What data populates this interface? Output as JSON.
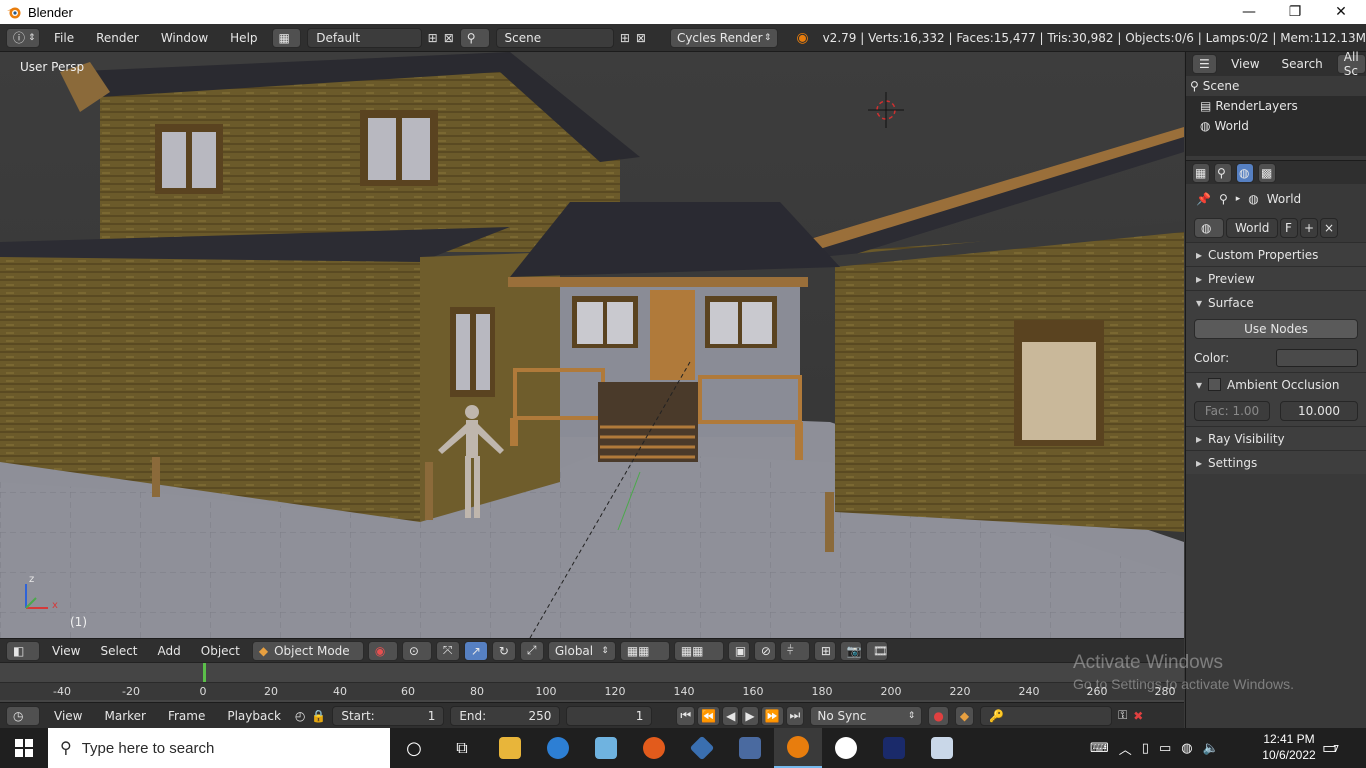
{
  "window": {
    "title": "Blender",
    "minimize_glyph": "—",
    "restore_glyph": "❐",
    "close_glyph": "✕"
  },
  "topbar": {
    "menus": [
      "File",
      "Render",
      "Window",
      "Help"
    ],
    "screen_layout": "Default",
    "scene": "Scene",
    "render_engine": "Cycles Render",
    "stats": "v2.79 | Verts:16,332 | Faces:15,477 | Tris:30,982 | Objects:0/6 | Lamps:0/2 | Mem:112.13M"
  },
  "viewport": {
    "view_label": "User Persp",
    "frame_indicator": "(1)",
    "axis_x": "x",
    "axis_z": "z"
  },
  "outliner": {
    "menus": [
      "View",
      "Search"
    ],
    "filter": "All Sc",
    "items": [
      "Scene",
      "RenderLayers",
      "World"
    ]
  },
  "properties": {
    "breadcrumb": "World",
    "datablock": "World",
    "fake_user": "F",
    "sections": {
      "custom_properties": "Custom Properties",
      "preview": "Preview",
      "surface": "Surface",
      "use_nodes": "Use Nodes",
      "color_label": "Color:",
      "ambient_occlusion": "Ambient Occlusion",
      "fac": "Fac: 1.00",
      "distance": "10.000",
      "ray_visibility": "Ray Visibility",
      "settings": "Settings"
    },
    "world_color": "#4a4a4a"
  },
  "toolbar3d": {
    "menus": [
      "View",
      "Select",
      "Add",
      "Object"
    ],
    "mode": "Object Mode",
    "orientation": "Global"
  },
  "timeline": {
    "ticks": [
      "-40",
      "-20",
      "0",
      "20",
      "40",
      "60",
      "80",
      "100",
      "120",
      "140",
      "160",
      "180",
      "200",
      "220",
      "240",
      "260",
      "280"
    ],
    "menus": [
      "View",
      "Marker",
      "Frame",
      "Playback"
    ],
    "start_label": "Start:",
    "start": "1",
    "end_label": "End:",
    "end": "250",
    "current": "1",
    "sync": "No Sync"
  },
  "watermark": {
    "line1": "Activate Windows",
    "line2": "Go to Settings to activate Windows."
  },
  "taskbar": {
    "search_placeholder": "Type here to search",
    "time": "12:41 PM",
    "date": "10/6/2022",
    "notifications": "7"
  }
}
